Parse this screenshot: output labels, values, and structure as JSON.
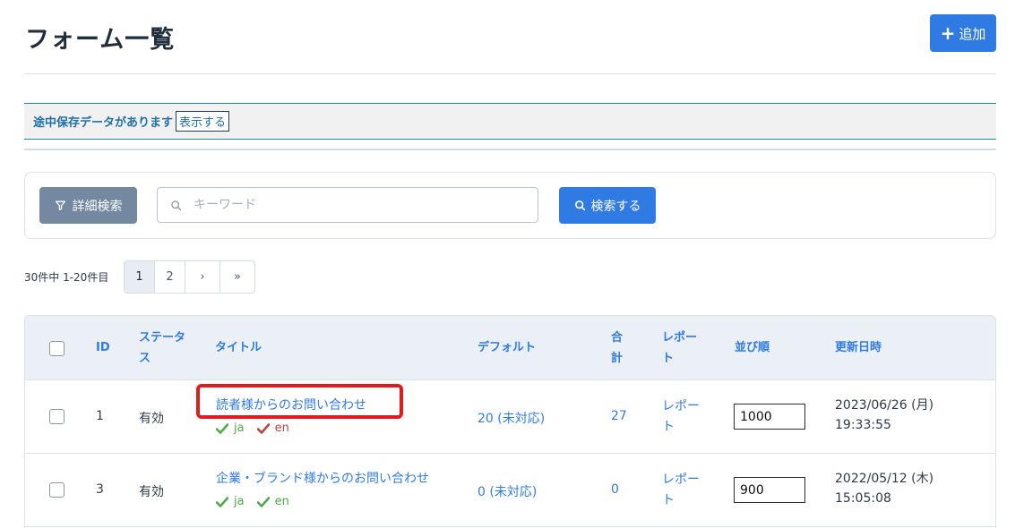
{
  "header": {
    "title": "フォーム一覧",
    "add_label": "追加"
  },
  "notice": {
    "message": "途中保存データがあります",
    "show_label": "表示する"
  },
  "search": {
    "advanced_label": "詳細検索",
    "keyword_placeholder": "キーワード",
    "search_label": "検索する"
  },
  "pagination": {
    "summary": "30件中 1-20件目",
    "pages": [
      "1",
      "2"
    ],
    "next": "›",
    "last": "»",
    "current": "1"
  },
  "table": {
    "columns": {
      "id": "ID",
      "status": "ステータス",
      "title": "タイトル",
      "default": "デフォルト",
      "total": "合計",
      "report": "レポート",
      "order": "並び順",
      "updated": "更新日時"
    },
    "rows": [
      {
        "id": "1",
        "status": "有効",
        "title": "読者様からのお問い合わせ",
        "langs": [
          {
            "code": "ja",
            "state": "ok"
          },
          {
            "code": "en",
            "state": "ng"
          }
        ],
        "default": "20 (未対応)",
        "total": "27",
        "report": "レポート",
        "order": "1000",
        "updated_date": "2023/06/26 (月)",
        "updated_time": "19:33:55"
      },
      {
        "id": "3",
        "status": "有効",
        "title": "企業・ブランド様からのお問い合わせ",
        "langs": [
          {
            "code": "ja",
            "state": "ok"
          },
          {
            "code": "en",
            "state": "ok"
          }
        ],
        "default": "0 (未対応)",
        "total": "0",
        "report": "レポート",
        "order": "900",
        "updated_date": "2022/05/12 (木)",
        "updated_time": "15:05:08"
      }
    ]
  },
  "colors": {
    "primary": "#2f7be3",
    "secondary_button": "#7488a1",
    "highlight": "#e11c1c",
    "lang_ok": "#4faa4a",
    "lang_ng": "#c0443e"
  }
}
